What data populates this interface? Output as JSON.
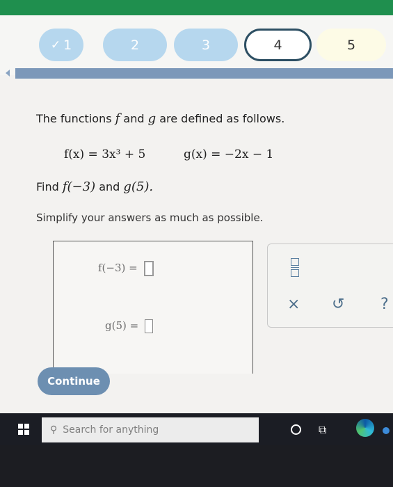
{
  "progress": {
    "steps": [
      {
        "label": "1",
        "state": "done",
        "prefix": "✓"
      },
      {
        "label": "2",
        "state": "done"
      },
      {
        "label": "3",
        "state": "done"
      },
      {
        "label": "4",
        "state": "current"
      },
      {
        "label": "5",
        "state": "todo"
      }
    ]
  },
  "question": {
    "intro_pre": "The functions ",
    "f": "f",
    "and": " and ",
    "g": "g",
    "intro_post": " are defined as follows.",
    "eq_f": "f(x) = 3x³ + 5",
    "eq_g": "g(x) = −2x − 1",
    "find_pre": "Find ",
    "find_f": "f(−3)",
    "find_and": " and ",
    "find_g": "g(5).",
    "simplify": "Simplify your answers as much as possible."
  },
  "answers": {
    "f_label": "f(−3) =",
    "g_label": "g(5) ="
  },
  "tools": {
    "clear": "×",
    "undo": "↺",
    "help": "?"
  },
  "continue_label": "Continue",
  "taskbar": {
    "search_placeholder": "Search for anything"
  }
}
